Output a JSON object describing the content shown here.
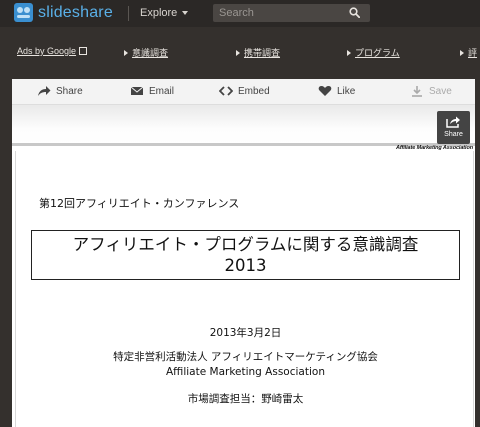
{
  "nav": {
    "logo_text": "slideshare",
    "explore_label": "Explore",
    "search_placeholder": "Search"
  },
  "ads": {
    "ads_by_google": "Ads by Google",
    "links": [
      "意識調査",
      "携帯調査",
      "プログラム",
      "評"
    ]
  },
  "toolbar": {
    "share": "Share",
    "email": "Email",
    "embed": "Embed",
    "like": "Like",
    "save": "Save"
  },
  "player": {
    "share_button": "Share",
    "association_tag": "Affiliate Marketing Association"
  },
  "slide": {
    "conference": "第12回アフィリエイト・カンファレンス",
    "title_line1": "アフィリエイト・プログラムに関する意識調査",
    "title_line2": "2013",
    "date": "2013年3月2日",
    "org_line1": "特定非営利活動法人 アフィリエイトマーケティング協会",
    "org_line2": "Affiliate Marketing Association",
    "responsible": "市場調査担当：野崎雷太"
  },
  "colors": {
    "brand_blue": "#3a8fd0",
    "topbar_bg": "#2b2826",
    "page_bg": "#34302d"
  }
}
